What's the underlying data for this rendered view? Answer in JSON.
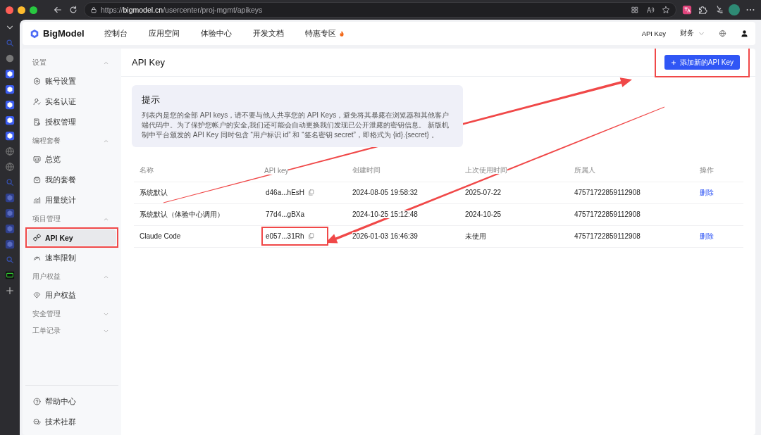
{
  "browser": {
    "url": "https://**bigmodel.cn**/usercenter/proj-mgmt/apikeys"
  },
  "header": {
    "logo": "BigModel",
    "nav": [
      {
        "label": "控制台",
        "hot": false
      },
      {
        "label": "应用空间",
        "hot": false
      },
      {
        "label": "体验中心",
        "hot": false
      },
      {
        "label": "开发文档",
        "hot": false
      },
      {
        "label": "特惠专区",
        "hot": true
      }
    ],
    "right": [
      {
        "label": "API Key",
        "dropdown": false
      },
      {
        "label": "财务",
        "dropdown": true
      }
    ]
  },
  "sidebar": {
    "groups": [
      {
        "title": "设置",
        "expanded": true,
        "items": [
          {
            "label": "账号设置",
            "selected": false,
            "highlighted": false
          },
          {
            "label": "实名认证",
            "selected": false,
            "highlighted": false
          },
          {
            "label": "授权管理",
            "selected": false,
            "highlighted": false
          }
        ]
      },
      {
        "title": "编程套餐",
        "expanded": true,
        "items": [
          {
            "label": "总览",
            "selected": false,
            "highlighted": false
          },
          {
            "label": "我的套餐",
            "selected": false,
            "highlighted": false
          },
          {
            "label": "用量统计",
            "selected": false,
            "highlighted": false
          }
        ]
      },
      {
        "title": "项目管理",
        "expanded": true,
        "items": [
          {
            "label": "API Key",
            "selected": true,
            "highlighted": true
          },
          {
            "label": "速率限制",
            "selected": false,
            "highlighted": false
          }
        ]
      },
      {
        "title": "用户权益",
        "expanded": true,
        "items": [
          {
            "label": "用户权益",
            "selected": false,
            "highlighted": false
          }
        ]
      },
      {
        "title": "安全管理",
        "expanded": false
      },
      {
        "title": "工单记录",
        "expanded": false
      }
    ],
    "footer": [
      {
        "label": "帮助中心"
      },
      {
        "label": "技术社群"
      }
    ]
  },
  "main": {
    "title": "API Key",
    "add_button": {
      "label": "添加新的API Key",
      "highlighted": true
    },
    "hint": {
      "title": "提示",
      "text": "列表内是您的全部 API keys，请不要与他人共享您的 API Keys，避免将其暴露在浏览器和其他客户端代码中。为了保护您帐户的安全,我们还可能会自动更换我们发现已公开泄露的密钥信息。 新版机制中平台颁发的 API Key 同时包含 “用户标识 id” 和 “签名密钥 secret”，即格式为 {id}.{secret} 。"
    },
    "table": {
      "columns": [
        "名称",
        "API key",
        "创建时间",
        "上次使用时间",
        "所属人",
        "操作"
      ],
      "rows": [
        {
          "name": "系统默认",
          "key": "d46a...hEsH",
          "copy": true,
          "highlighted": false,
          "created": "2024-08-05 19:58:32",
          "last_used": "2025-07-22",
          "owner": "47571722859112908",
          "action": "删除"
        },
        {
          "name": "系统默认（体验中心调用）",
          "key": "77d4...gBXa",
          "copy": false,
          "highlighted": false,
          "created": "2024-10-25 15:12:48",
          "last_used": "2024-10-25",
          "owner": "47571722859112908"
        },
        {
          "name": "Claude Code",
          "key": "e057...31Rh",
          "copy": true,
          "highlighted": true,
          "created": "2026-01-03 16:46:39",
          "last_used": "未使用",
          "owner": "47571722859112908",
          "action": "删除"
        }
      ]
    }
  }
}
